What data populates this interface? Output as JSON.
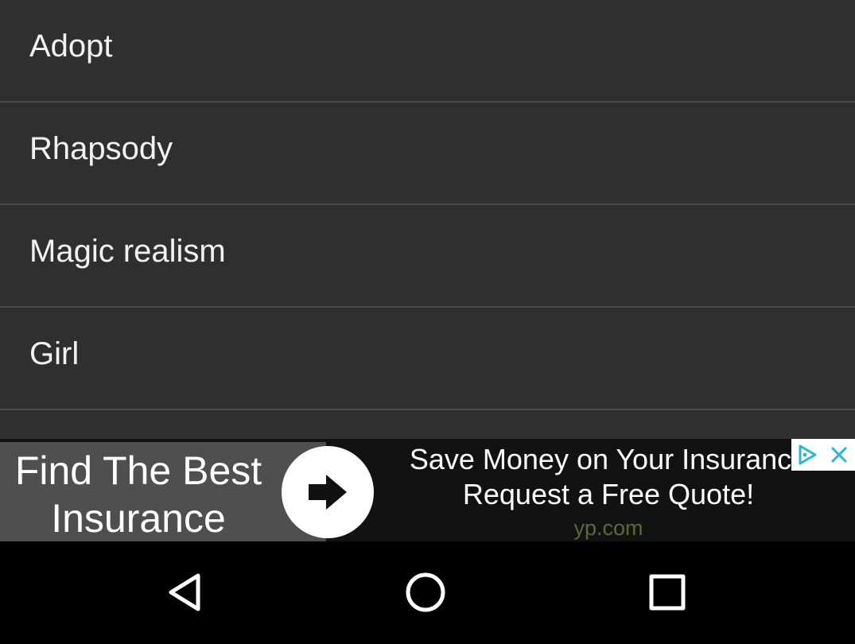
{
  "list": {
    "items": [
      {
        "label": "Adopt"
      },
      {
        "label": "Rhapsody"
      },
      {
        "label": "Magic realism"
      },
      {
        "label": "Girl"
      },
      {
        "label": ""
      }
    ]
  },
  "ad": {
    "headline": "Find The Best Insurance",
    "line1": "Save Money on Your Insurance",
    "line2": "Request a Free Quote!",
    "domain": "yp.com",
    "arrow_icon": "arrow-right-icon",
    "choices_icon": "adchoices-icon",
    "close_icon": "close-icon"
  },
  "nav": {
    "back_icon": "back-triangle-icon",
    "home_icon": "home-circle-icon",
    "recents_icon": "recents-square-icon"
  },
  "colors": {
    "list_background": "#2f2f2f",
    "divider": "#4a4a4a",
    "ad_left_background": "#4f4f4f",
    "ad_background": "#121212",
    "ad_domain": "#5a6a36",
    "ad_choices_accent": "#29b6d9",
    "nav_background": "#000000"
  }
}
